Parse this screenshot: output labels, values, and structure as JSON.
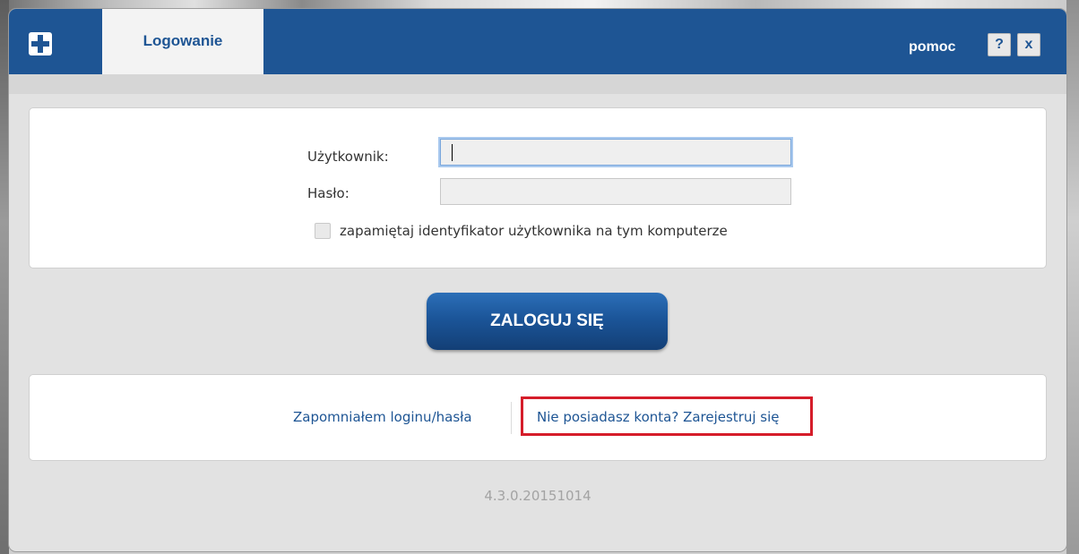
{
  "window": {
    "tab_title": "Logowanie",
    "help_link": "pomoc",
    "help_button": "?",
    "close_button": "x"
  },
  "login_form": {
    "username_label": "Użytkownik:",
    "username_value": "",
    "password_label": "Hasło:",
    "password_value": "",
    "remember_label": "zapamiętaj identyfikator użytkownika na tym komputerze",
    "remember_checked": false
  },
  "login_button": "ZALOGUJ SIĘ",
  "links": {
    "forgot": "Zapomniałem loginu/hasła",
    "register": "Nie posiadasz konta? Zarejestruj się"
  },
  "version": "4.3.0.20151014",
  "colors": {
    "brand_blue": "#1e5594",
    "highlight_red": "#d51d2a"
  }
}
